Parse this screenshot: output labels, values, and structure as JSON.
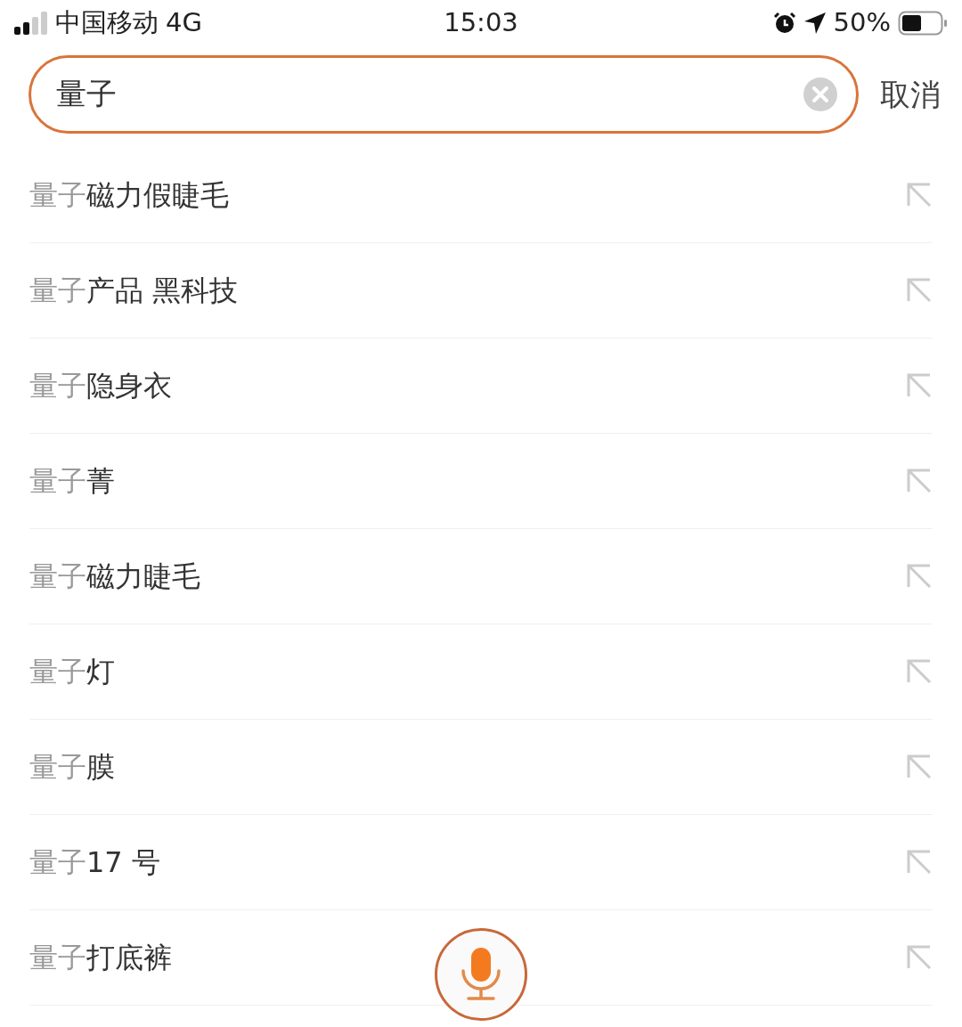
{
  "status_bar": {
    "carrier": "中国移动",
    "network": "4G",
    "time": "15:03",
    "battery": "50%"
  },
  "search": {
    "value": "量子",
    "cancel": "取消"
  },
  "suggestions": [
    {
      "match": "量子",
      "rest": "磁力假睫毛"
    },
    {
      "match": "量子",
      "rest": "产品 黑科技"
    },
    {
      "match": "量子",
      "rest": "隐身衣"
    },
    {
      "match": "量子",
      "rest": "菁"
    },
    {
      "match": "量子",
      "rest": "磁力睫毛"
    },
    {
      "match": "量子",
      "rest": "灯"
    },
    {
      "match": "量子",
      "rest": "膜"
    },
    {
      "match": "量子",
      "rest": "17 号"
    },
    {
      "match": "量子",
      "rest": "打底裤"
    }
  ]
}
